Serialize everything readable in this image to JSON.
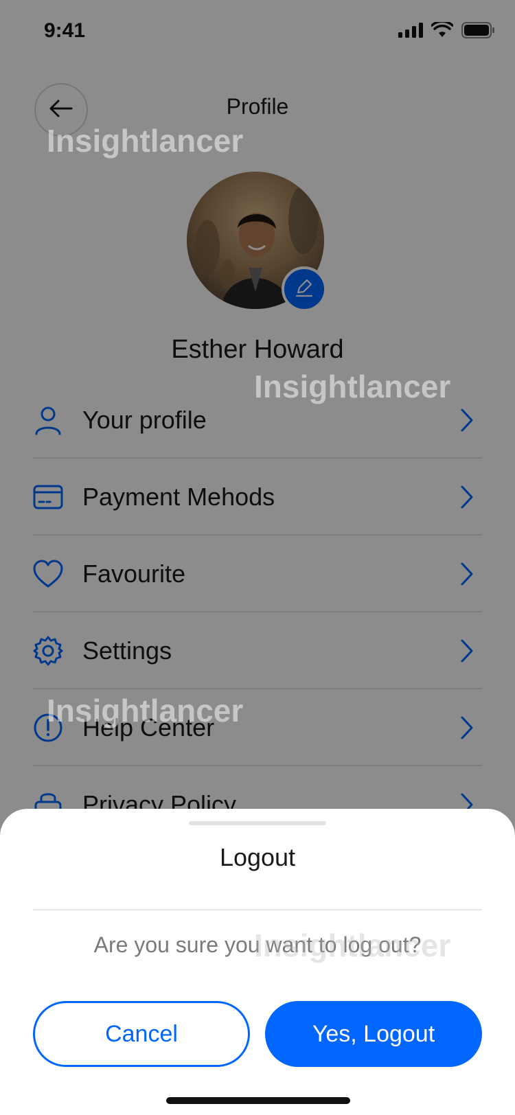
{
  "status_bar": {
    "time": "9:41",
    "icons": [
      "signal-icon",
      "wifi-icon",
      "battery-icon"
    ]
  },
  "header": {
    "title": "Profile",
    "back_icon": "arrow-left-icon"
  },
  "profile": {
    "name": "Esther Howard",
    "edit_icon": "pencil-icon"
  },
  "menu": {
    "items": [
      {
        "label": "Your profile",
        "icon": "user-icon"
      },
      {
        "label": "Payment Mehods",
        "icon": "card-icon"
      },
      {
        "label": "Favourite",
        "icon": "heart-icon"
      },
      {
        "label": "Settings",
        "icon": "gear-icon"
      },
      {
        "label": "Help Center",
        "icon": "exclamation-circle-icon"
      },
      {
        "label": "Privacy Policy",
        "icon": "lock-icon"
      }
    ],
    "chevron_icon": "chevron-right-icon"
  },
  "watermark": {
    "text": "Insightlancer"
  },
  "logout_sheet": {
    "title": "Logout",
    "message": "Are you sure you want to log out?",
    "cancel_label": "Cancel",
    "confirm_label": "Yes, Logout"
  },
  "colors": {
    "accent": "#0066ff",
    "text": "#1a1a1a",
    "muted": "#7a7a7a",
    "divider": "#e6e6e6"
  }
}
